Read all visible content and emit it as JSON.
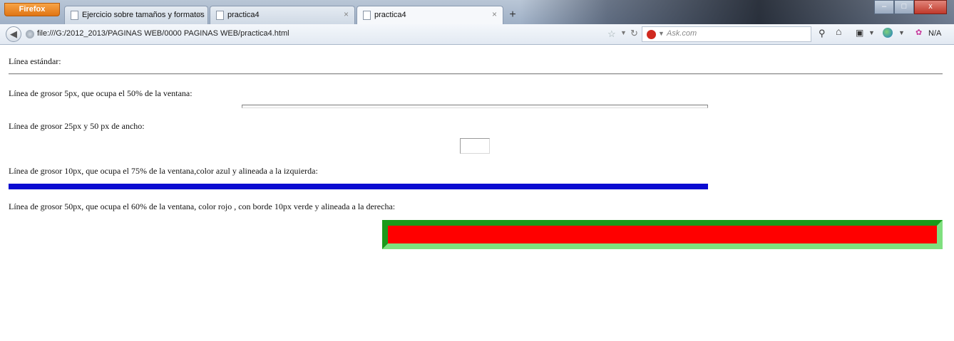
{
  "browser": {
    "menu_button": "Firefox",
    "tabs": [
      {
        "label": "Ejercicio sobre tamaños y formatos",
        "close": "×"
      },
      {
        "label": "practica4",
        "close": "×"
      },
      {
        "label": "practica4",
        "close": "×"
      }
    ],
    "new_tab": "+",
    "window_buttons": {
      "minimize": "–",
      "maximize": "□",
      "close": "x"
    },
    "address": "file:///G:/2012_2013/PAGINAS WEB/0000 PAGINAS WEB/practica4.html",
    "search_placeholder": "Ask.com",
    "toolbar_text": "N/A"
  },
  "page": {
    "labels": [
      "Línea estándar:",
      "Línea de grosor 5px, que ocupa el 50% de la ventana:",
      "Línea de grosor 25px y 50 px de ancho:",
      "Línea de grosor 10px, que ocupa el 75% de la ventana,color azul y alineada a la izquierda:",
      "Línea de grosor 50px, que ocupa el 60% de la ventana, color rojo , con borde 10px verde y alineada a la derecha:"
    ]
  },
  "colors": {
    "blue_line": "#0a0bd1",
    "red_line": "#ff0000",
    "green_border": "#1a9a1a",
    "light_green_border": "#7fe07f"
  }
}
